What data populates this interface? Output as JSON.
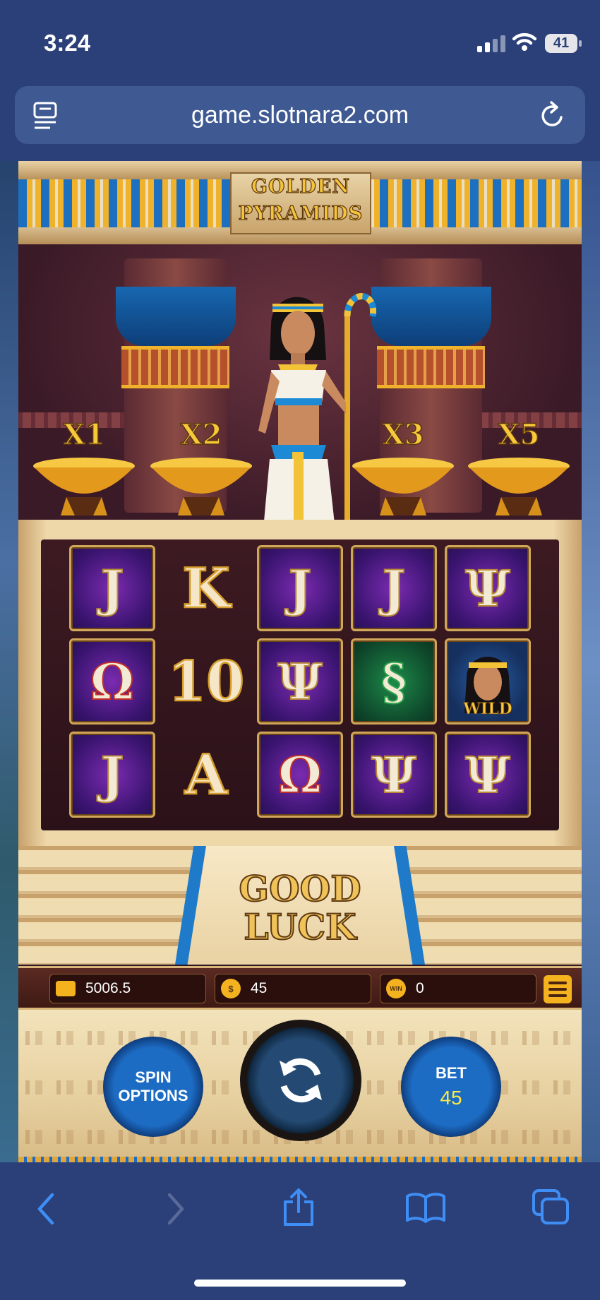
{
  "status_bar": {
    "time": "3:24",
    "battery": "41",
    "icons": [
      "cellular-signal-icon",
      "wifi-icon",
      "battery-icon"
    ]
  },
  "browser": {
    "url": "game.slotnara2.com",
    "icons": [
      "reader-icon",
      "reload-icon"
    ]
  },
  "game": {
    "title_line1": "GOLDEN",
    "title_line2": "PYRAMIDS",
    "multipliers": [
      "X1",
      "X2",
      "X3",
      "X5"
    ],
    "reels": [
      [
        "J",
        "K",
        "J",
        "J",
        "Ψ"
      ],
      [
        "Ω",
        "10",
        "Ψ",
        "§",
        "WILD"
      ],
      [
        "J",
        "A",
        "Ω",
        "Ψ",
        "Ψ"
      ]
    ],
    "message_line1": "GOOD",
    "message_line2": "LUCK",
    "balance": "5006.5",
    "coin_icon_label": "$",
    "bet_amount": "45",
    "win_icon_label": "WIN",
    "win_amount": "0",
    "spin_options_line1": "SPIN",
    "spin_options_line2": "OPTIONS",
    "bet_label": "BET",
    "bet_value": "45"
  },
  "colors": {
    "browser_bg": "#2b4079",
    "url_bar": "#3f5a92",
    "gold": "#f3b21e",
    "bet_value": "#ffe845"
  },
  "toolbar": {
    "icons": [
      "back-icon",
      "forward-icon",
      "share-icon",
      "bookmarks-icon",
      "tabs-icon"
    ]
  }
}
